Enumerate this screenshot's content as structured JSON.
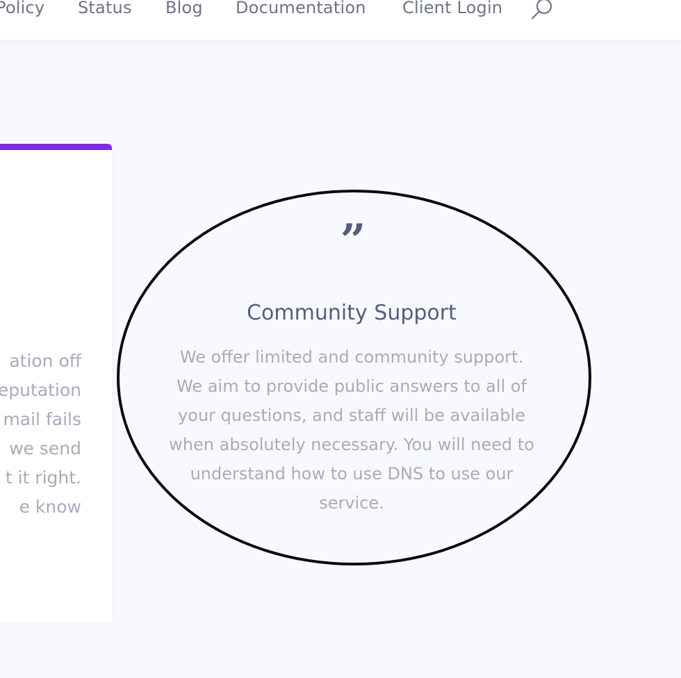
{
  "nav": {
    "items": [
      "Policy",
      "Status",
      "Blog",
      "Documentation",
      "Client Login"
    ],
    "search_icon": "search-icon"
  },
  "left_card": {
    "accent_color": "#7a2ee0",
    "lines": [
      "ation off",
      "eputation",
      "mail fails",
      " we send",
      "t it right.",
      "e know"
    ]
  },
  "support_card": {
    "quote_icon": "”",
    "title": "Community Support",
    "lines": [
      "We offer limited and community support.",
      "We aim to provide public answers to all of",
      "your questions, and staff will be available",
      "when absolutely necessary. You will need to",
      "understand how to use DNS to use our",
      "service."
    ]
  }
}
